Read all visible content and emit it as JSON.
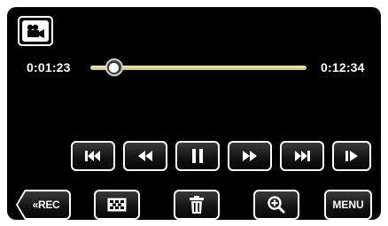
{
  "player": {
    "mode_icon": "video-camera-icon",
    "current_time": "0:01:23",
    "total_time": "0:12:34",
    "progress": 0.11
  },
  "transport": {
    "icons": [
      "skip-previous-icon",
      "rewind-icon",
      "pause-icon",
      "fast-forward-icon",
      "skip-next-icon",
      "slow-forward-icon"
    ]
  },
  "bottom_bar": {
    "rec_label": "«REC",
    "menu_label": "MENU",
    "icons": [
      "thumbnail-index-icon",
      "delete-trash-icon",
      "zoom-in-icon"
    ]
  },
  "colors": {
    "background": "#000000",
    "button_border": "#ffffff",
    "seek_track": "#e6d79a"
  }
}
